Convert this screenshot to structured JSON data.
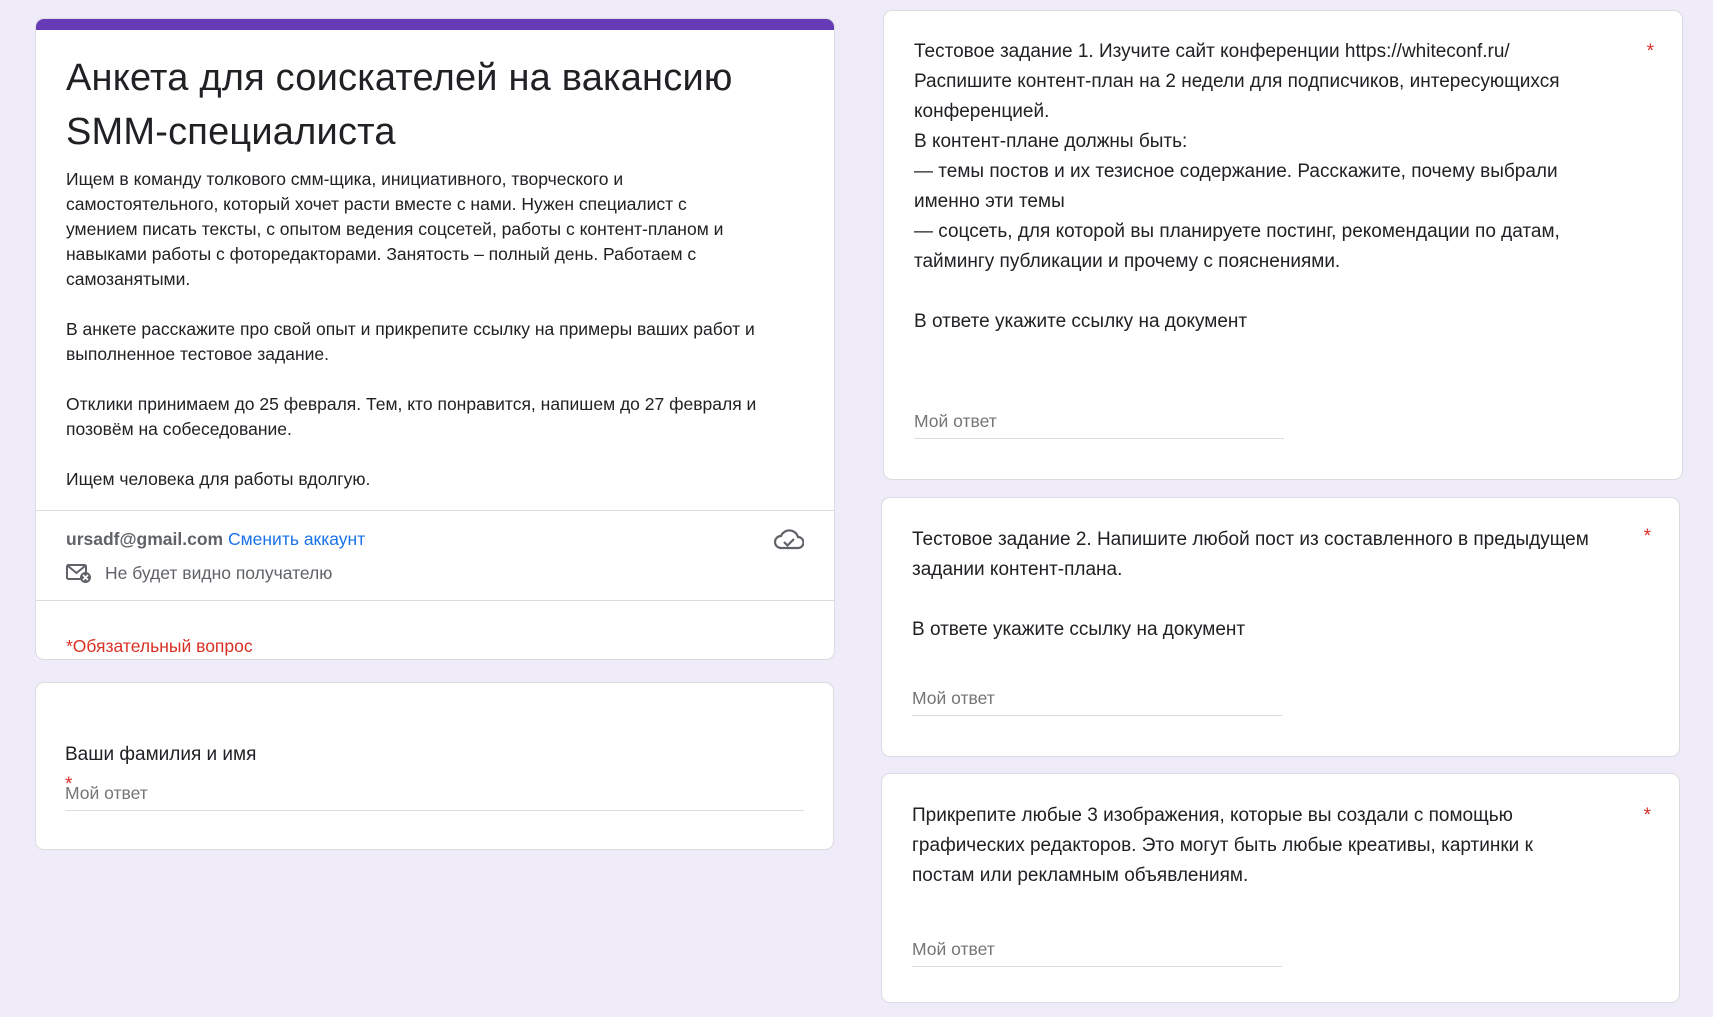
{
  "header": {
    "title": "Анкета для соискателей на вакансию SMM-специалиста",
    "description": "Ищем в команду толкового смм-щика, инициативного, творческого и\nсамостоятельного, который хочет расти вместе с нами. Нужен специалист с\nумением писать тексты, с опытом ведения соцсетей, работы с контент-планом и\nнавыками работы с фоторедакторами. Занятость – полный день. Работаем с\nсамозанятыми.\n\nВ анкете расскажите про свой опыт и прикрепите ссылку на примеры ваших работ и\nвыполненное тестовое задание.\n\nОтклики принимаем до 25 февраля. Тем, кто понравится, напишем до 27 февраля и\nпозовём на собеседование.\n\nИщем человека для работы вдолгую.",
    "email": "ursadf@gmail.com",
    "switch_account": "Сменить аккаунт",
    "hidden_note": "Не будет видно получателю",
    "required_note": "*Обязательный вопрос",
    "accent_color": "#673ab7",
    "icons": [
      "cloud-check-icon",
      "mail-hidden-icon"
    ]
  },
  "questions": [
    {
      "text": "Ваши фамилия и имя",
      "required": "*",
      "placeholder": "Мой ответ"
    },
    {
      "text": "Тестовое задание 1. Изучите сайт конференции https://whiteconf.ru/\nРаспишите контент-план на 2 недели для подписчиков,  интересующихся\nконференцией.\nВ контент-плане должны быть:\n— темы постов и их тезисное содержание. Расскажите, почему выбрали\nименно эти темы\n— соцсеть, для которой вы планируете постинг, рекомендации по датам,\nтаймингу публикации и прочему с пояснениями.\n\nВ ответе укажите ссылку на документ",
      "required": "*",
      "placeholder": "Мой ответ"
    },
    {
      "text": "Тестовое задание 2. Напишите любой пост из составленного в предыдущем\nзадании контент-плана.\n\nВ ответе укажите ссылку на документ",
      "required": "*",
      "placeholder": "Мой ответ"
    },
    {
      "text": "Прикрепите любые 3 изображения, которые вы создали с помощью\nграфических редакторов. Это могут быть любые креативы, картинки к\nпостам или рекламным объявлениям.",
      "required": "*",
      "placeholder": "Мой ответ"
    }
  ]
}
